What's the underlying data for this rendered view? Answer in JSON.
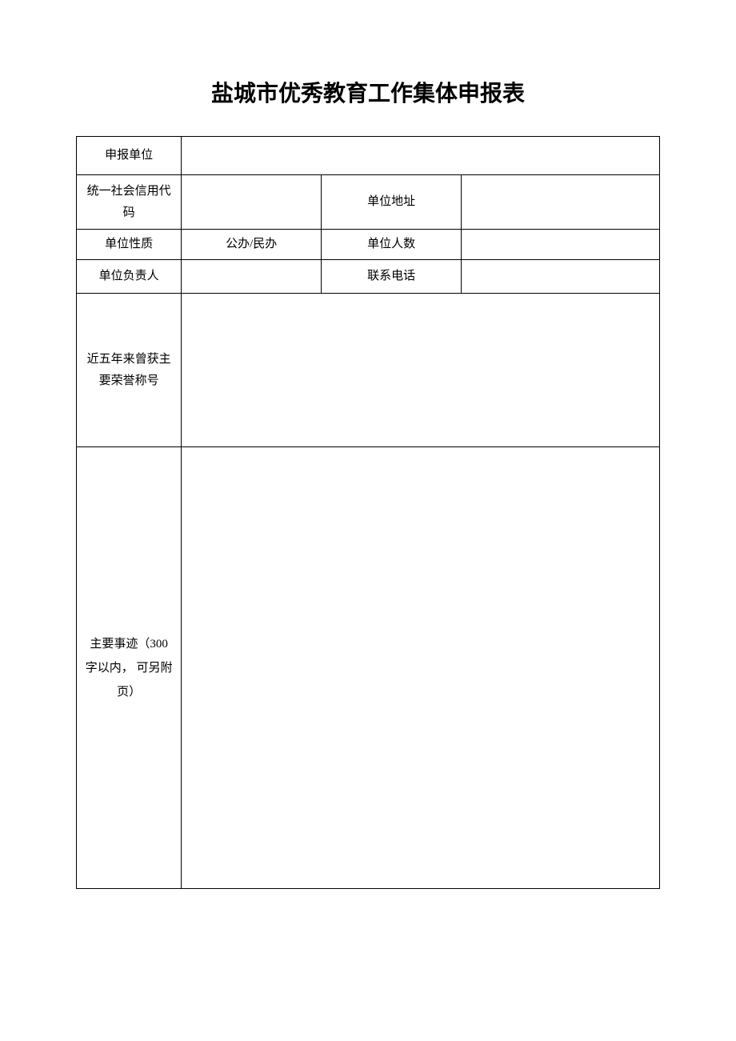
{
  "title": "盐城市优秀教育工作集体申报表",
  "labels": {
    "applying_unit": "申报单位",
    "credit_code": "统一社会信用代码",
    "unit_address": "单位地址",
    "unit_nature": "单位性质",
    "nature_option": "公办/民办",
    "unit_count": "单位人数",
    "unit_head": "单位负责人",
    "contact_phone": "联系电话",
    "honors": "近五年来曾获主要荣誉称号",
    "main_deeds": "主要事迹（300 字以内， 可另附页）"
  },
  "values": {
    "applying_unit": "",
    "credit_code": "",
    "unit_address": "",
    "unit_count": "",
    "unit_head": "",
    "contact_phone": "",
    "honors": "",
    "main_deeds": ""
  }
}
